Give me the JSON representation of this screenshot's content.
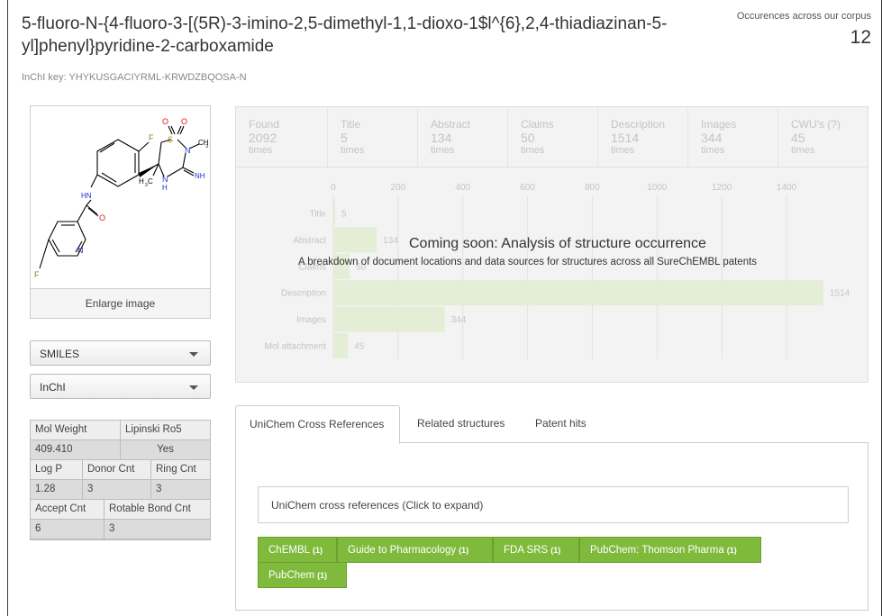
{
  "header": {
    "title": "5-fluoro-N-{4-fluoro-3-[(5R)-3-imino-2,5-dimethyl-1,1-dioxo-1$l^{6},2,4-thiadiazinan-5-yl]phenyl}pyridine-2-carboxamide",
    "inchi_key": "InChI key: YHYKUSGACIYRML-KRWDZBQOSA-N",
    "occurrences_label": "Occurences across our corpus",
    "occurrences_value": "12"
  },
  "structure": {
    "enlarge_label": "Enlarge image",
    "atoms": {
      "F1": "F",
      "S": "S",
      "O1": "O",
      "O2": "O",
      "N2": "N",
      "CH3a": "CH",
      "CH3a_sub": "3",
      "NH_imine": "NH",
      "NH_ring": "N",
      "H_ring": "H",
      "H3C": "H",
      "H3C_sub": "3",
      "H3C_c": "C",
      "NH_amide": "HN",
      "O_amide": "O",
      "N_py": "N",
      "F2": "F"
    }
  },
  "dropdowns": {
    "smiles": "SMILES",
    "inchi": "InChI"
  },
  "properties": {
    "row1_head": [
      "Mol Weight",
      "Lipinski Ro5"
    ],
    "row1_val": [
      "409.410",
      "Yes"
    ],
    "row2_head": [
      "Log P",
      "Donor Cnt",
      "Ring Cnt"
    ],
    "row2_val": [
      "1.28",
      "3",
      "3"
    ],
    "row3_head": [
      "Accept Cnt",
      "Rotable Bond Cnt"
    ],
    "row3_val": [
      "6",
      "3"
    ]
  },
  "stat_tabs": [
    {
      "label": "Found",
      "value": "2092",
      "unit": "times"
    },
    {
      "label": "Title",
      "value": "5",
      "unit": "times"
    },
    {
      "label": "Abstract",
      "value": "134",
      "unit": "times"
    },
    {
      "label": "Claims",
      "value": "50",
      "unit": "times"
    },
    {
      "label": "Description",
      "value": "1514",
      "unit": "times"
    },
    {
      "label": "Images",
      "value": "344",
      "unit": "times"
    },
    {
      "label": "CWU's (?)",
      "value": "45",
      "unit": "times"
    }
  ],
  "chart_data": {
    "type": "bar",
    "orientation": "horizontal",
    "categories": [
      "Title",
      "Abstract",
      "Claims",
      "Description",
      "Images",
      "Mol attachment"
    ],
    "values": [
      5,
      134,
      50,
      1514,
      344,
      45
    ],
    "xticks": [
      0,
      200,
      400,
      600,
      800,
      1000,
      1200,
      1400
    ],
    "xlim": [
      0,
      1500
    ],
    "grid": true,
    "bar_color": "#e4eed6",
    "text_color": "#c4c4c4"
  },
  "overlay": {
    "title": "Coming soon: Analysis of structure occurrence",
    "subtitle": "A breakdown of document locations and data sources for structures across all SureChEMBL patents"
  },
  "tabs": {
    "items": [
      "UniChem Cross References",
      "Related structures",
      "Patent hits"
    ],
    "xref_expand": "UniChem cross references (Click to expand)",
    "badges": [
      {
        "label": "ChEMBL",
        "count": "(1)"
      },
      {
        "label": "Guide to Pharmacology",
        "count": "(1)"
      },
      {
        "label": "FDA SRS",
        "count": "(1)"
      },
      {
        "label": "PubChem: Thomson Pharma",
        "count": "(1)"
      },
      {
        "label": "PubChem",
        "count": "(1)"
      }
    ],
    "badge_color": "#7fba3c"
  }
}
